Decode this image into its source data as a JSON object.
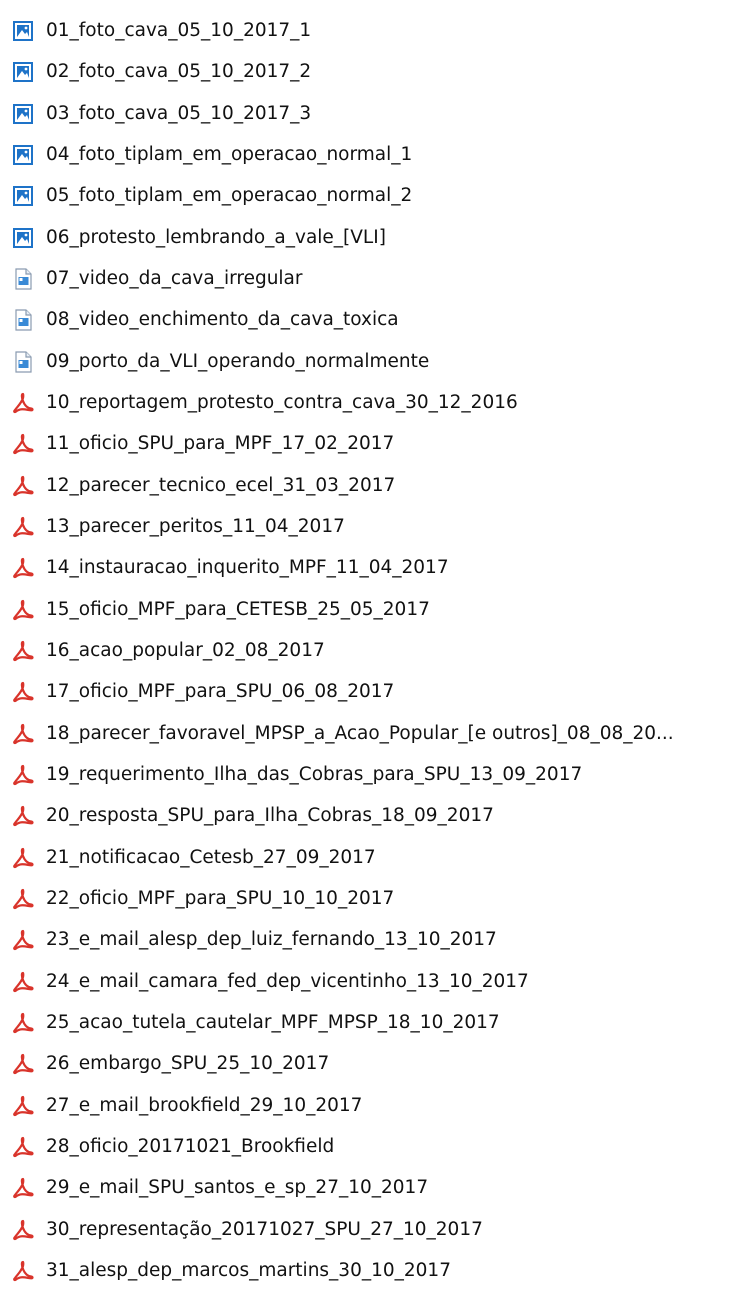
{
  "files": [
    {
      "name": "01_foto_cava_05_10_2017_1",
      "icon": "image-file-icon"
    },
    {
      "name": "02_foto_cava_05_10_2017_2",
      "icon": "image-file-icon"
    },
    {
      "name": "03_foto_cava_05_10_2017_3",
      "icon": "image-file-icon"
    },
    {
      "name": "04_foto_tiplam_em_operacao_normal_1",
      "icon": "image-file-icon"
    },
    {
      "name": "05_foto_tiplam_em_operacao_normal_2",
      "icon": "image-file-icon"
    },
    {
      "name": "06_protesto_lembrando_a_vale_[VLI]",
      "icon": "image-file-icon"
    },
    {
      "name": "07_video_da_cava_irregular",
      "icon": "video-file-icon"
    },
    {
      "name": "08_video_enchimento_da_cava_toxica",
      "icon": "video-file-icon"
    },
    {
      "name": "09_porto_da_VLI_operando_normalmente",
      "icon": "video-file-icon"
    },
    {
      "name": "10_reportagem_protesto_contra_cava_30_12_2016",
      "icon": "pdf-file-icon"
    },
    {
      "name": "11_oficio_SPU_para_MPF_17_02_2017",
      "icon": "pdf-file-icon"
    },
    {
      "name": "12_parecer_tecnico_ecel_31_03_2017",
      "icon": "pdf-file-icon"
    },
    {
      "name": "13_parecer_peritos_11_04_2017",
      "icon": "pdf-file-icon"
    },
    {
      "name": "14_instauracao_inquerito_MPF_11_04_2017",
      "icon": "pdf-file-icon"
    },
    {
      "name": "15_oficio_MPF_para_CETESB_25_05_2017",
      "icon": "pdf-file-icon"
    },
    {
      "name": "16_acao_popular_02_08_2017",
      "icon": "pdf-file-icon"
    },
    {
      "name": "17_oficio_MPF_para_SPU_06_08_2017",
      "icon": "pdf-file-icon"
    },
    {
      "name": "18_parecer_favoravel_MPSP_a_Acao_Popular_[e outros]_08_08_20...",
      "icon": "pdf-file-icon"
    },
    {
      "name": "19_requerimento_Ilha_das_Cobras_para_SPU_13_09_2017",
      "icon": "pdf-file-icon"
    },
    {
      "name": "20_resposta_SPU_para_Ilha_Cobras_18_09_2017",
      "icon": "pdf-file-icon"
    },
    {
      "name": "21_notificacao_Cetesb_27_09_2017",
      "icon": "pdf-file-icon"
    },
    {
      "name": "22_oficio_MPF_para_SPU_10_10_2017",
      "icon": "pdf-file-icon"
    },
    {
      "name": "23_e_mail_alesp_dep_luiz_fernando_13_10_2017",
      "icon": "pdf-file-icon"
    },
    {
      "name": "24_e_mail_camara_fed_dep_vicentinho_13_10_2017",
      "icon": "pdf-file-icon"
    },
    {
      "name": "25_acao_tutela_cautelar_MPF_MPSP_18_10_2017",
      "icon": "pdf-file-icon"
    },
    {
      "name": "26_embargo_SPU_25_10_2017",
      "icon": "pdf-file-icon"
    },
    {
      "name": "27_e_mail_brookfield_29_10_2017",
      "icon": "pdf-file-icon"
    },
    {
      "name": "28_oficio_20171021_Brookfield",
      "icon": "pdf-file-icon"
    },
    {
      "name": "29_e_mail_SPU_santos_e_sp_27_10_2017",
      "icon": "pdf-file-icon"
    },
    {
      "name": "30_representação_20171027_SPU_27_10_2017",
      "icon": "pdf-file-icon"
    },
    {
      "name": "31_alesp_dep_marcos_martins_30_10_2017",
      "icon": "pdf-file-icon"
    }
  ],
  "colors": {
    "image_icon_blue": "#1e73c8",
    "video_icon_blue": "#3a8ad6",
    "pdf_icon_red": "#d9342b",
    "text": "#111111"
  }
}
